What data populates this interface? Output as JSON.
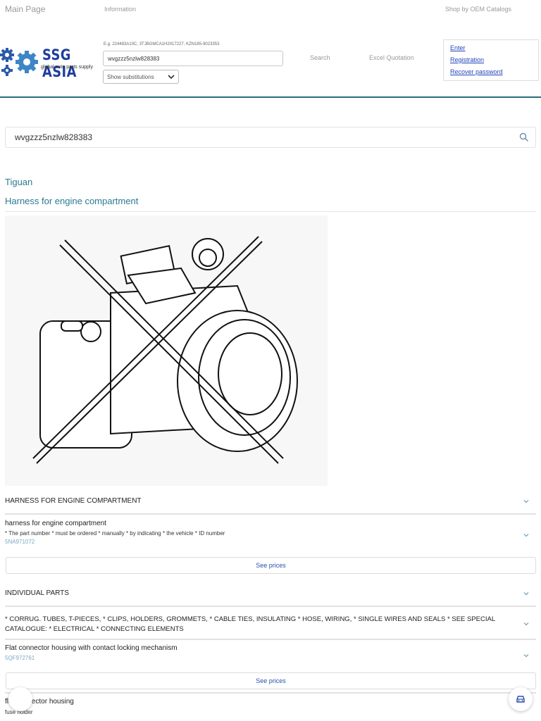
{
  "topnav": {
    "main_page": "Main Page",
    "information": "Information",
    "oem_catalogs": "Shop by OEM Catalogs"
  },
  "header": {
    "logo_brand": "SSG ASIA",
    "logo_tagline": "global auto parts supply",
    "search_hint": "E.g. 224483A10C, 3TJBGMCA1H2017227, KZN185-9023353",
    "search_value": "wvgzzz5nzlw828383",
    "substitutions_label": "Show substitutions",
    "search_button": "Search",
    "excel_button": "Excel Quotation",
    "auth": {
      "enter": "Enter",
      "registration": "Registration",
      "recover": "Recover password"
    }
  },
  "vin_search": {
    "value": "wvgzzz5nzlw828383",
    "icon": "search-icon"
  },
  "vehicle": {
    "model": "Tiguan",
    "group": "Harness for engine compartment"
  },
  "parts": {
    "section1_title": "HARNESS FOR ENGINE COMPARTMENT",
    "item1": {
      "name": "harness for engine compartment",
      "desc": "* The part number * must be ordered * manually * by indicating * the vehicle * ID number",
      "number": "5NA971072",
      "prices": "See prices"
    },
    "section2_title": "INDIVIDUAL PARTS",
    "section2_desc": "* CORRUG. TUBES, T-PIECES, * CLIPS, HOLDERS, GROMMETS, * CABLE TIES, INSULATING * HOSE, WIRING, * SINGLE WIRES AND SEALS * SEE SPECIAL CATALOGUE: * ELECTRICAL * CONNECTING ELEMENTS",
    "item2": {
      "name": "Flat connector housing with contact locking mechanism",
      "number": "5QF972761",
      "prices": "See prices"
    },
    "item3": {
      "name": "flat connector housing",
      "desc": "fuse holder"
    }
  },
  "colors": {
    "accent": "#2a7a93",
    "header_border": "#2a6b78",
    "link": "#2244bb",
    "part_number": "#7aa8c3",
    "logo": "#1f3e9e"
  }
}
